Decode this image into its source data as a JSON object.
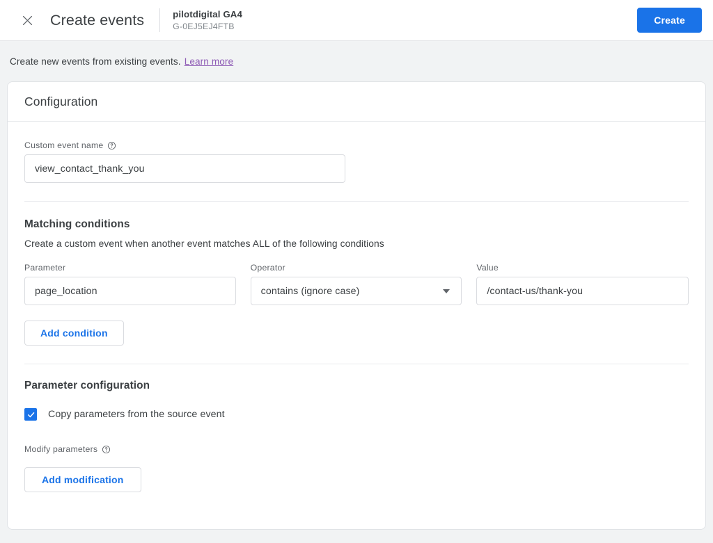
{
  "header": {
    "close_icon": "close-icon",
    "title": "Create events",
    "property_name": "pilotdigital GA4",
    "property_id": "G-0EJ5EJ4FTB",
    "create_label": "Create",
    "accent_color": "#1a73e8"
  },
  "notice": {
    "text": "Create new events from existing events.",
    "link_label": "Learn more",
    "link_color": "#8e5bb5",
    "background": "#f1f3f4"
  },
  "card": {
    "title": "Configuration"
  },
  "custom_event": {
    "label": "Custom event name",
    "help_icon": "help-circle-icon",
    "value": "view_contact_thank_you",
    "placeholder": "Custom event name"
  },
  "matching_conditions": {
    "title": "Matching conditions",
    "description": "Create a custom event when another event matches ALL of the following conditions",
    "columns": {
      "parameter": "Parameter",
      "operator": "Operator",
      "value": "Value"
    },
    "rows": [
      {
        "parameter": "page_location",
        "operator": "contains (ignore case)",
        "value": "/contact-us/thank-you"
      }
    ],
    "add_condition_label": "Add condition"
  },
  "parameter_configuration": {
    "title": "Parameter configuration",
    "copy_params_label": "Copy parameters from the source event",
    "copy_params_checked": true,
    "modify_params_label": "Modify parameters",
    "modify_help_icon": "help-circle-icon",
    "add_modification_label": "Add modification"
  }
}
